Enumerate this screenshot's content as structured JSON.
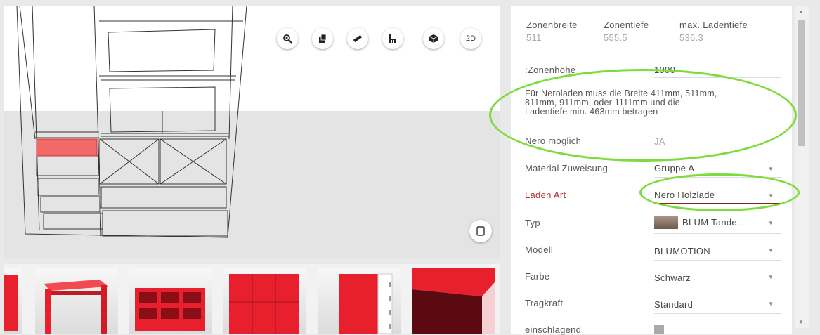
{
  "viewport": {
    "toolbar": [
      {
        "name": "zoom-icon",
        "label": ""
      },
      {
        "name": "copy-icon",
        "label": ""
      },
      {
        "name": "measure-icon",
        "label": ""
      },
      {
        "name": "furniture-icon",
        "label": ""
      },
      {
        "name": "cube-icon",
        "label": ""
      },
      {
        "name": "view-2d",
        "label": "2D"
      }
    ]
  },
  "thumbnails": [
    {
      "name": "thumb-panel"
    },
    {
      "name": "thumb-desk"
    },
    {
      "name": "thumb-shelf"
    },
    {
      "name": "thumb-cabinet-doors"
    },
    {
      "name": "thumb-drawer-unit"
    },
    {
      "name": "thumb-corner"
    }
  ],
  "colors": {
    "accent_red": "#e8202e",
    "highlight_green": "#7ddc3b",
    "label_red": "#b03030"
  },
  "panel": {
    "zone": {
      "breite_label": "Zonenbreite",
      "breite_value": "511",
      "tiefe_label": "Zonentiefe",
      "tiefe_value": "555.5",
      "ladentiefe_label": "max. Ladentiefe",
      "ladentiefe_value": "536.3"
    },
    "hoehe_label": ":Zonenhöhe",
    "hoehe_value": "1000",
    "note_line1": "Für Neroladen muss die Breite 411mm, 511mm,",
    "note_line2": "811mm, 911mm, oder 1111mm und die",
    "note_line3": "Ladentiefe min. 463mm betragen",
    "nero_label": "Nero möglich",
    "nero_value": "JA",
    "fields": [
      {
        "label": "Material Zuweisung",
        "value": "Gruppe A"
      },
      {
        "label": "Laden Art",
        "value": "Nero Holzlade"
      },
      {
        "label": "Typ",
        "value": "BLUM Tande.."
      },
      {
        "label": "Modell",
        "value": "BLUMOTION"
      },
      {
        "label": "Farbe",
        "value": "Schwarz"
      },
      {
        "label": "Tragkraft",
        "value": "Standard"
      },
      {
        "label": "einschlagend",
        "value": ""
      }
    ]
  }
}
